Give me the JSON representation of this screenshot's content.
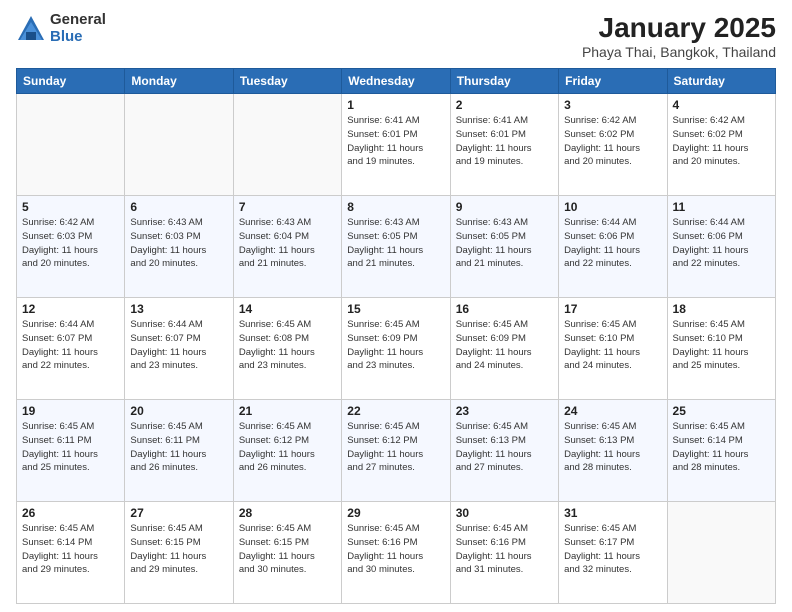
{
  "header": {
    "logo_general": "General",
    "logo_blue": "Blue",
    "title": "January 2025",
    "location": "Phaya Thai, Bangkok, Thailand"
  },
  "days_of_week": [
    "Sunday",
    "Monday",
    "Tuesday",
    "Wednesday",
    "Thursday",
    "Friday",
    "Saturday"
  ],
  "weeks": [
    [
      {
        "day": "",
        "info": ""
      },
      {
        "day": "",
        "info": ""
      },
      {
        "day": "",
        "info": ""
      },
      {
        "day": "1",
        "info": "Sunrise: 6:41 AM\nSunset: 6:01 PM\nDaylight: 11 hours\nand 19 minutes."
      },
      {
        "day": "2",
        "info": "Sunrise: 6:41 AM\nSunset: 6:01 PM\nDaylight: 11 hours\nand 19 minutes."
      },
      {
        "day": "3",
        "info": "Sunrise: 6:42 AM\nSunset: 6:02 PM\nDaylight: 11 hours\nand 20 minutes."
      },
      {
        "day": "4",
        "info": "Sunrise: 6:42 AM\nSunset: 6:02 PM\nDaylight: 11 hours\nand 20 minutes."
      }
    ],
    [
      {
        "day": "5",
        "info": "Sunrise: 6:42 AM\nSunset: 6:03 PM\nDaylight: 11 hours\nand 20 minutes."
      },
      {
        "day": "6",
        "info": "Sunrise: 6:43 AM\nSunset: 6:03 PM\nDaylight: 11 hours\nand 20 minutes."
      },
      {
        "day": "7",
        "info": "Sunrise: 6:43 AM\nSunset: 6:04 PM\nDaylight: 11 hours\nand 21 minutes."
      },
      {
        "day": "8",
        "info": "Sunrise: 6:43 AM\nSunset: 6:05 PM\nDaylight: 11 hours\nand 21 minutes."
      },
      {
        "day": "9",
        "info": "Sunrise: 6:43 AM\nSunset: 6:05 PM\nDaylight: 11 hours\nand 21 minutes."
      },
      {
        "day": "10",
        "info": "Sunrise: 6:44 AM\nSunset: 6:06 PM\nDaylight: 11 hours\nand 22 minutes."
      },
      {
        "day": "11",
        "info": "Sunrise: 6:44 AM\nSunset: 6:06 PM\nDaylight: 11 hours\nand 22 minutes."
      }
    ],
    [
      {
        "day": "12",
        "info": "Sunrise: 6:44 AM\nSunset: 6:07 PM\nDaylight: 11 hours\nand 22 minutes."
      },
      {
        "day": "13",
        "info": "Sunrise: 6:44 AM\nSunset: 6:07 PM\nDaylight: 11 hours\nand 23 minutes."
      },
      {
        "day": "14",
        "info": "Sunrise: 6:45 AM\nSunset: 6:08 PM\nDaylight: 11 hours\nand 23 minutes."
      },
      {
        "day": "15",
        "info": "Sunrise: 6:45 AM\nSunset: 6:09 PM\nDaylight: 11 hours\nand 23 minutes."
      },
      {
        "day": "16",
        "info": "Sunrise: 6:45 AM\nSunset: 6:09 PM\nDaylight: 11 hours\nand 24 minutes."
      },
      {
        "day": "17",
        "info": "Sunrise: 6:45 AM\nSunset: 6:10 PM\nDaylight: 11 hours\nand 24 minutes."
      },
      {
        "day": "18",
        "info": "Sunrise: 6:45 AM\nSunset: 6:10 PM\nDaylight: 11 hours\nand 25 minutes."
      }
    ],
    [
      {
        "day": "19",
        "info": "Sunrise: 6:45 AM\nSunset: 6:11 PM\nDaylight: 11 hours\nand 25 minutes."
      },
      {
        "day": "20",
        "info": "Sunrise: 6:45 AM\nSunset: 6:11 PM\nDaylight: 11 hours\nand 26 minutes."
      },
      {
        "day": "21",
        "info": "Sunrise: 6:45 AM\nSunset: 6:12 PM\nDaylight: 11 hours\nand 26 minutes."
      },
      {
        "day": "22",
        "info": "Sunrise: 6:45 AM\nSunset: 6:12 PM\nDaylight: 11 hours\nand 27 minutes."
      },
      {
        "day": "23",
        "info": "Sunrise: 6:45 AM\nSunset: 6:13 PM\nDaylight: 11 hours\nand 27 minutes."
      },
      {
        "day": "24",
        "info": "Sunrise: 6:45 AM\nSunset: 6:13 PM\nDaylight: 11 hours\nand 28 minutes."
      },
      {
        "day": "25",
        "info": "Sunrise: 6:45 AM\nSunset: 6:14 PM\nDaylight: 11 hours\nand 28 minutes."
      }
    ],
    [
      {
        "day": "26",
        "info": "Sunrise: 6:45 AM\nSunset: 6:14 PM\nDaylight: 11 hours\nand 29 minutes."
      },
      {
        "day": "27",
        "info": "Sunrise: 6:45 AM\nSunset: 6:15 PM\nDaylight: 11 hours\nand 29 minutes."
      },
      {
        "day": "28",
        "info": "Sunrise: 6:45 AM\nSunset: 6:15 PM\nDaylight: 11 hours\nand 30 minutes."
      },
      {
        "day": "29",
        "info": "Sunrise: 6:45 AM\nSunset: 6:16 PM\nDaylight: 11 hours\nand 30 minutes."
      },
      {
        "day": "30",
        "info": "Sunrise: 6:45 AM\nSunset: 6:16 PM\nDaylight: 11 hours\nand 31 minutes."
      },
      {
        "day": "31",
        "info": "Sunrise: 6:45 AM\nSunset: 6:17 PM\nDaylight: 11 hours\nand 32 minutes."
      },
      {
        "day": "",
        "info": ""
      }
    ]
  ]
}
